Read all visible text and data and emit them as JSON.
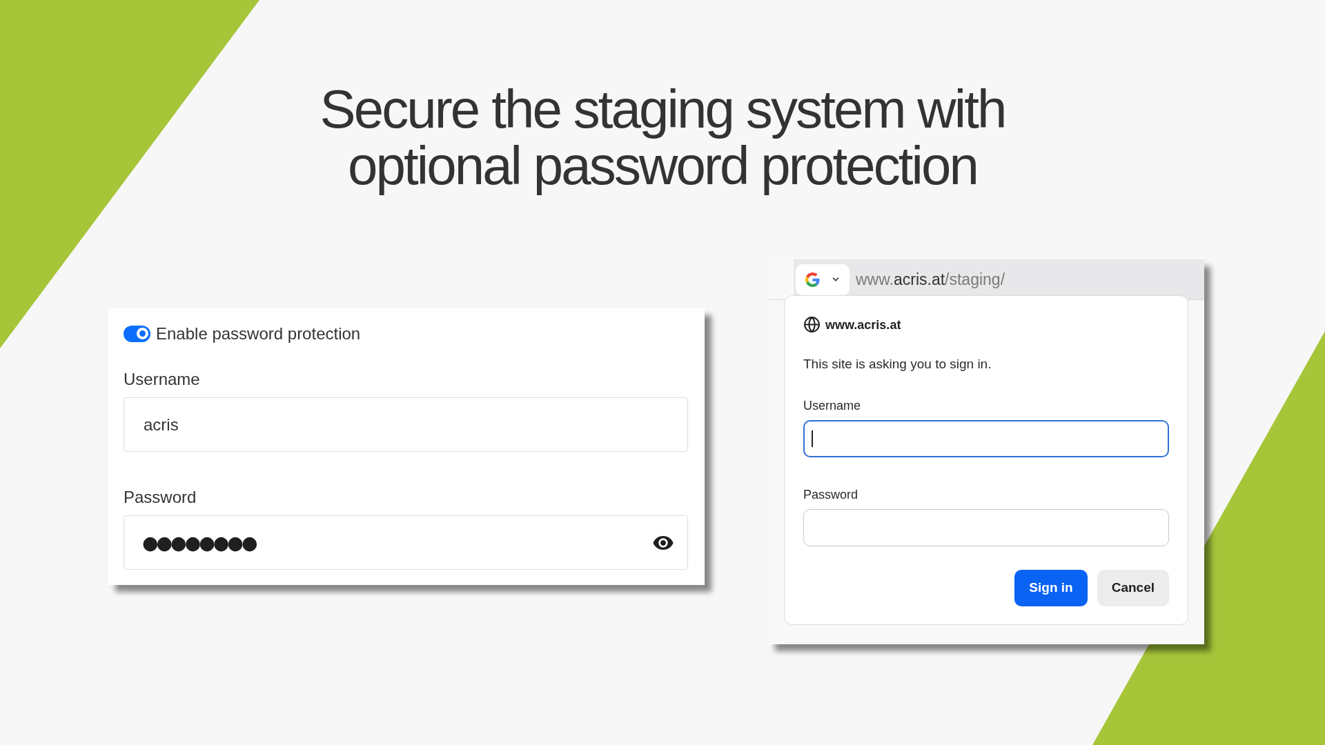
{
  "headline": {
    "lines": [
      "Secure the staging system with",
      "optional password protection"
    ]
  },
  "settings_panel": {
    "toggle": {
      "label": "Enable password protection",
      "on": true
    },
    "fields": [
      {
        "kind": "text",
        "label": "Username",
        "value": "acris"
      },
      {
        "kind": "password",
        "label": "Password",
        "value": "●●●●●●●●"
      }
    ]
  },
  "browser": {
    "address_bar": {
      "url": {
        "prefix": "www.",
        "host": "acris.at",
        "path": "/staging/"
      }
    },
    "sign_in_dialog": {
      "site": "www.acris.at",
      "message": "This site is asking you to sign in.",
      "fields": [
        {
          "label": "Username",
          "focused": true
        },
        {
          "label": "Password",
          "focused": false
        }
      ],
      "buttons": [
        {
          "kind": "primary",
          "label": "Sign in"
        },
        {
          "kind": "secondary",
          "label": "Cancel"
        }
      ]
    }
  }
}
